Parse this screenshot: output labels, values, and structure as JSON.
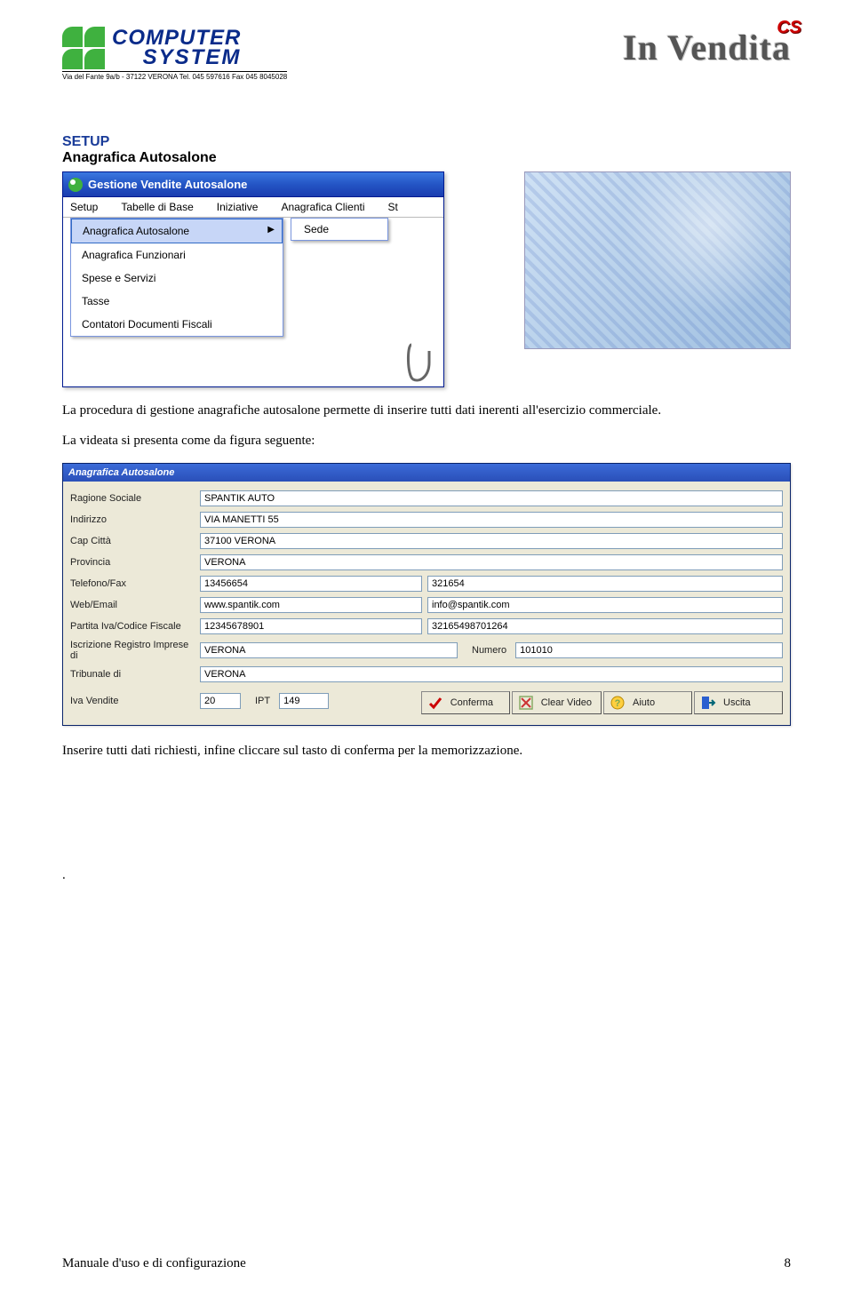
{
  "header": {
    "logo_line1": "COMPUTER",
    "logo_line2": "SYSTEM",
    "logo_sub": "Via del Fante 9a/b  -  37122 VERONA    Tel. 045 597616    Fax 045 8045028",
    "title_right": "In Vendita",
    "title_right_badge": "CS"
  },
  "section": {
    "heading": "SETUP",
    "subheading": "Anagrafica Autosalone"
  },
  "xp_window": {
    "title": "Gestione Vendite Autosalone",
    "menubar": [
      "Setup",
      "Tabelle di Base",
      "Iniziative",
      "Anagrafica Clienti",
      "St"
    ],
    "dropdown": [
      "Anagrafica Autosalone",
      "Anagrafica Funzionari",
      "Spese e Servizi",
      "Tasse",
      "Contatori Documenti Fiscali"
    ],
    "submenu": [
      "Sede"
    ]
  },
  "paragraph1": "La procedura di gestione anagrafiche autosalone permette di inserire tutti dati inerenti all'esercizio commerciale.",
  "paragraph2": "La videata si presenta come da figura seguente:",
  "form": {
    "title": "Anagrafica Autosalone",
    "labels": {
      "ragione": "Ragione Sociale",
      "indirizzo": "Indirizzo",
      "cap": "Cap Città",
      "provincia": "Provincia",
      "telfax": "Telefono/Fax",
      "webmail": "Web/Email",
      "pivacf": "Partita Iva/Codice Fiscale",
      "iscr": "Iscrizione Registro Imprese di",
      "numero": "Numero",
      "tribunale": "Tribunale di",
      "iva": "Iva Vendite",
      "ipt": "IPT"
    },
    "values": {
      "ragione": "SPANTIK AUTO",
      "indirizzo": "VIA MANETTI 55",
      "cap": "37100 VERONA",
      "provincia": "VERONA",
      "tel": "13456654",
      "fax": "321654",
      "web": "www.spantik.com",
      "email": "info@spantik.com",
      "piva": "12345678901",
      "cf": "32165498701264",
      "iscr": "VERONA",
      "numero": "101010",
      "tribunale": "VERONA",
      "iva": "20",
      "ipt": "149"
    },
    "buttons": {
      "conferma": "Conferma",
      "clear": "Clear Video",
      "aiuto": "Aiuto",
      "uscita": "Uscita"
    }
  },
  "paragraph3": "Inserire tutti dati richiesti, infine cliccare sul tasto di conferma per la memorizzazione.",
  "paragraph4": ".",
  "footer": {
    "left": "Manuale d'uso e di configurazione",
    "right": "8"
  }
}
